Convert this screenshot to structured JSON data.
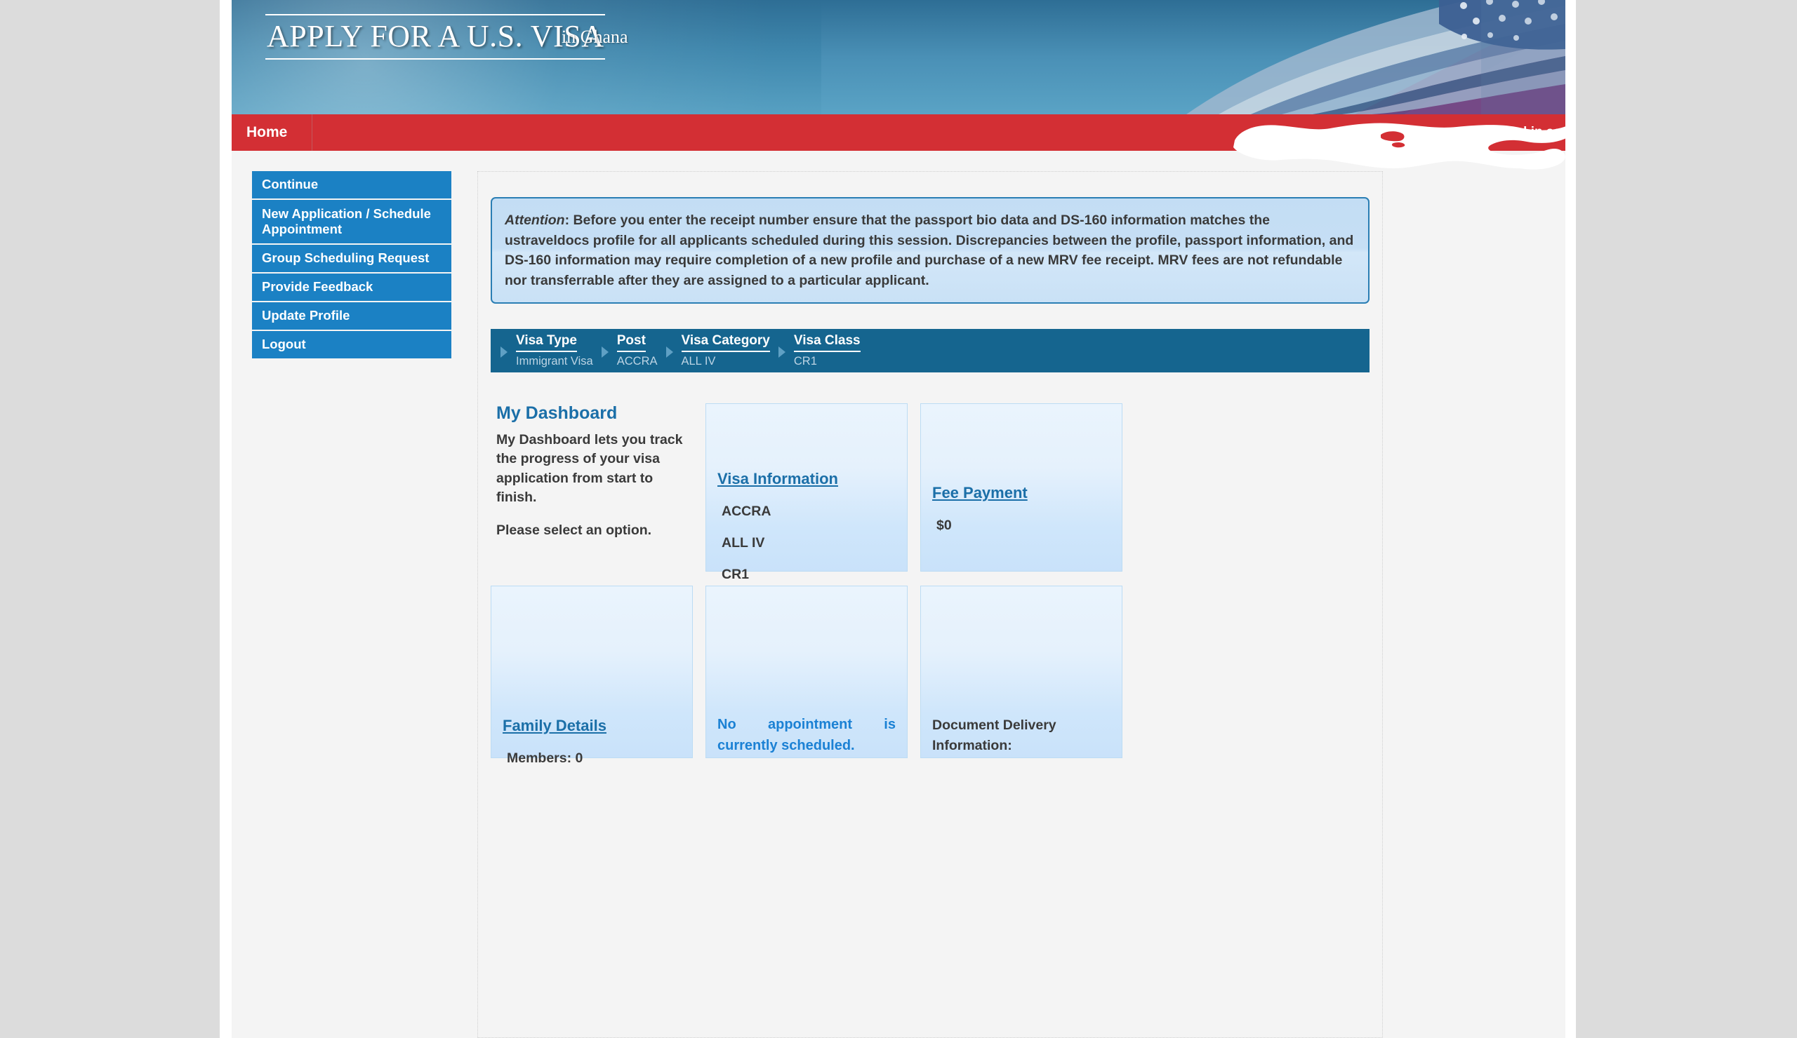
{
  "banner": {
    "title": "APPLY FOR A U.S. VISA",
    "subtitle": "in  Ghana"
  },
  "navbar": {
    "home_label": "Home",
    "logged_in_label": "Logged in as",
    "logged_in_user": ""
  },
  "sidebar": {
    "items": [
      {
        "label": "Continue"
      },
      {
        "label": "New Application / Schedule Appointment"
      },
      {
        "label": "Group Scheduling Request"
      },
      {
        "label": "Provide Feedback"
      },
      {
        "label": "Update Profile"
      },
      {
        "label": "Logout"
      }
    ]
  },
  "attention": {
    "lead": "Attention",
    "body": ": Before you enter the receipt number ensure that the passport bio data and DS-160 information matches the ustraveldocs profile for all applicants scheduled during this session. Discrepancies between the profile, passport information, and DS-160 information may require completion of a new profile and purchase of a new MRV fee receipt. MRV fees are not refundable nor transferrable after they are assigned to a particular applicant."
  },
  "breadcrumb": {
    "steps": [
      {
        "label": "Visa Type",
        "value": "Immigrant Visa"
      },
      {
        "label": "Post",
        "value": "ACCRA"
      },
      {
        "label": "Visa Category",
        "value": "ALL IV"
      },
      {
        "label": "Visa Class",
        "value": "CR1"
      }
    ]
  },
  "dashboard": {
    "intro": {
      "title": "My Dashboard",
      "paragraph1": "My Dashboard lets you track the progress of your visa application from start to finish.",
      "paragraph2": "Please select an option."
    },
    "visa_information": {
      "link": "Visa Information",
      "post": "ACCRA",
      "category": "ALL IV",
      "visa_class": "CR1"
    },
    "fee_payment": {
      "link": "Fee Payment",
      "amount": "$0"
    },
    "family_details": {
      "link": "Family Details",
      "members": "Members: 0"
    },
    "appointment": {
      "message": "No appointment is currently scheduled."
    },
    "document_delivery": {
      "line1": "Document Delivery",
      "line2": "Information:"
    }
  },
  "colors": {
    "nav_red": "#d32f34",
    "sidebar_blue": "#1b81c4",
    "breadcrumb_blue": "#15658f",
    "link_blue": "#1b6fa8",
    "accent_blue": "#1b81d4",
    "attention_border": "#2a7eb4",
    "page_bg": "#f4f4f4",
    "outer_bg": "#dcdcdc"
  }
}
